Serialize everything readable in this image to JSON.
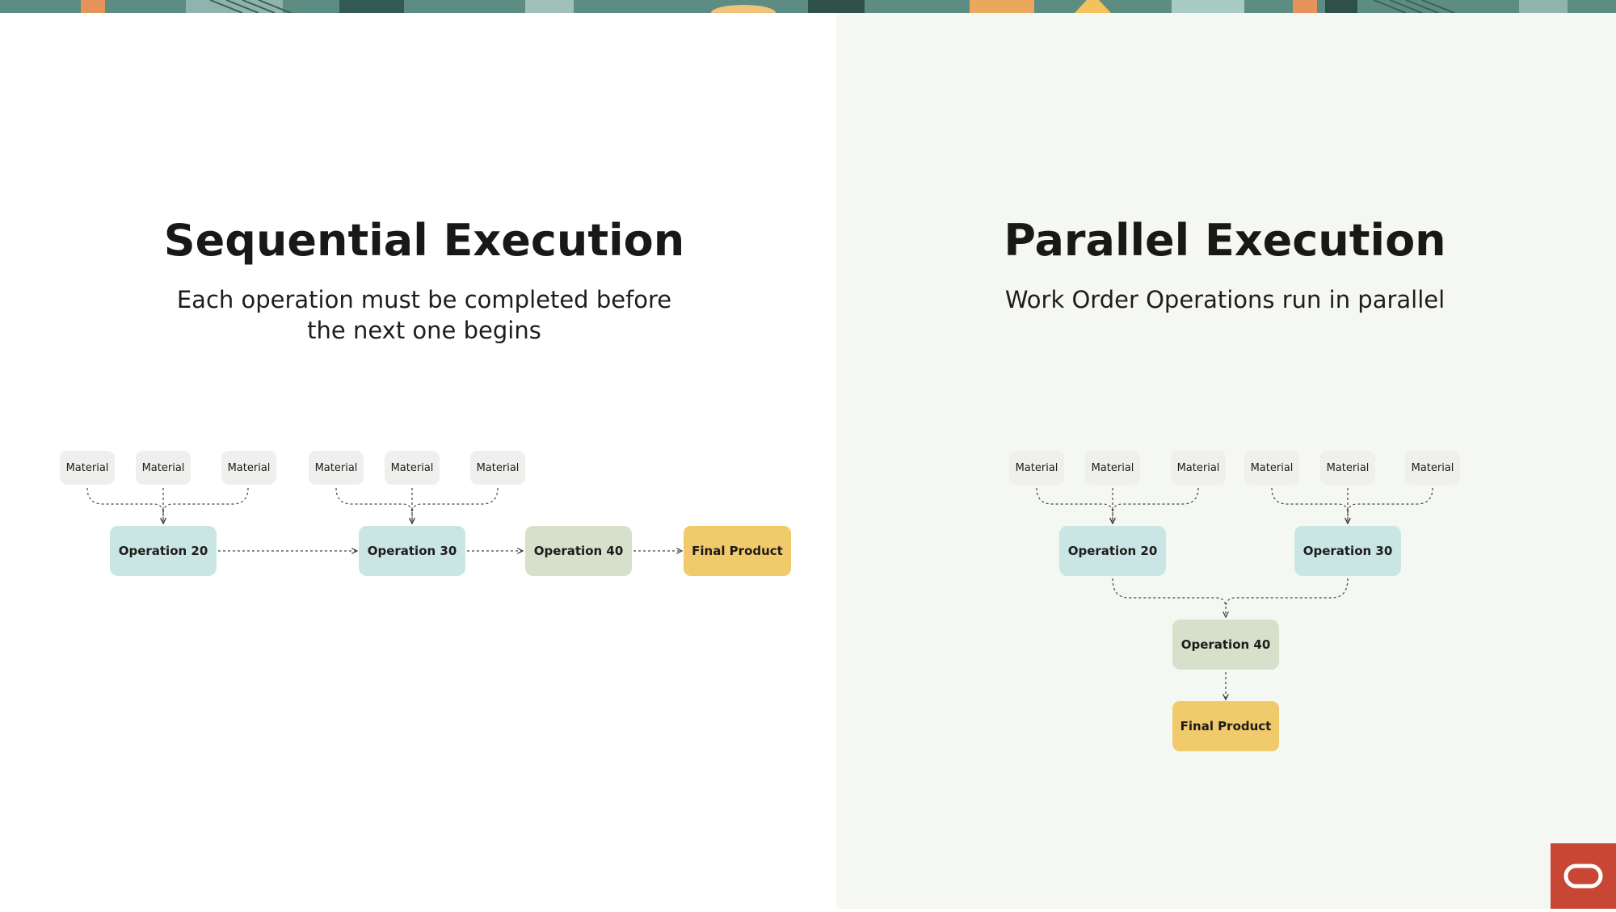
{
  "left": {
    "title": "Sequential Execution",
    "subtitle_line1": "Each operation must be completed before",
    "subtitle_line2": "the next one begins",
    "materials": [
      "Material",
      "Material",
      "Material",
      "Material",
      "Material",
      "Material"
    ],
    "op20": "Operation 20",
    "op30": "Operation 30",
    "op40": "Operation 40",
    "final": "Final Product"
  },
  "right": {
    "title": "Parallel Execution",
    "subtitle": "Work Order Operations run in parallel",
    "materials": [
      "Material",
      "Material",
      "Material",
      "Material",
      "Material",
      "Material"
    ],
    "op20": "Operation 20",
    "op30": "Operation 30",
    "op40": "Operation 40",
    "final": "Final Product"
  },
  "colors": {
    "operation": "#c9e6e4",
    "operation_40": "#d6e0cb",
    "final_product": "#f0ca6b",
    "material": "#efefed",
    "right_panel": "#f5f7f3",
    "logo": "#c74634"
  },
  "logo": {
    "icon": "oracle-logo-icon"
  }
}
